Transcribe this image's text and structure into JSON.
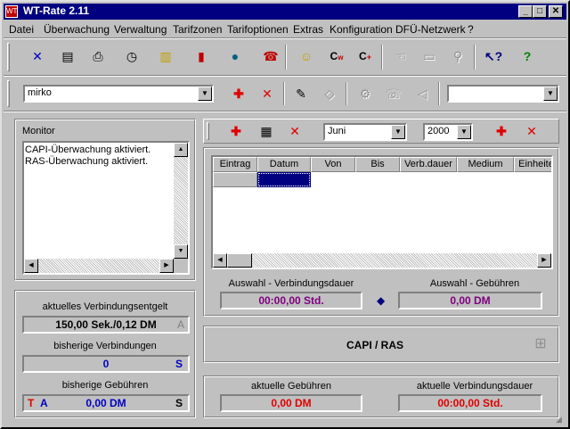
{
  "window": {
    "title": "WT-Rate 2.11",
    "icon_label": "WT"
  },
  "menu": [
    {
      "label": "Datei"
    },
    {
      "label": "Überwachung"
    },
    {
      "label": "Verwaltung"
    },
    {
      "label": "Tarifzonen"
    },
    {
      "label": "Tarifoptionen"
    },
    {
      "label": "Extras"
    },
    {
      "label": "Konfiguration"
    },
    {
      "label": "DFÜ-Netzwerk"
    },
    {
      "label": "?"
    }
  ],
  "toolbar": {
    "icons": [
      "close-x-icon",
      "document-icon",
      "printer-icon",
      "stopwatch-icon",
      "books-icon",
      "chart-icon",
      "globe-icon",
      "phone-icon",
      "smiley-icon",
      "cost-w-icon",
      "cost-plus-icon",
      "hand-icon",
      "battery-icon",
      "magnifier-icon",
      "context-help-icon",
      "help-icon"
    ]
  },
  "profile": {
    "selected": "mirko"
  },
  "profile_right_combo": {
    "value": ""
  },
  "monitor": {
    "title": "Monitor",
    "lines": [
      "CAPI-Überwachung aktiviert.",
      "RAS-Überwachung aktiviert."
    ]
  },
  "left_panel": {
    "entgelt_label": "aktuelles Verbindungsentgelt",
    "entgelt_value": "150,00 Sek./0,12 DM",
    "entgelt_suffix": "A",
    "verbindungen_label": "bisherige Verbindungen",
    "verbindungen_value": "0",
    "verbindungen_suffix": "S",
    "gebuehren_label": "bisherige Gebühren",
    "gebuehren_prefix_t": "T",
    "gebuehren_prefix_a": "A",
    "gebuehren_value": "0,00 DM",
    "gebuehren_suffix": "S"
  },
  "filter": {
    "month": "Juni",
    "year": "2000"
  },
  "table": {
    "columns": [
      "Eintrag",
      "Datum",
      "Von",
      "Bis",
      "Verb.dauer",
      "Medium",
      "Einheite"
    ],
    "rows": []
  },
  "auswahl": {
    "dauer_label": "Auswahl - Verbindungsdauer",
    "dauer_value": "00:00,00 Std.",
    "gebuehren_label": "Auswahl - Gebühren",
    "gebuehren_value": "0,00 DM"
  },
  "status": {
    "mode": "CAPI / RAS"
  },
  "aktuell": {
    "gebuehren_label": "aktuelle Gebühren",
    "gebuehren_value": "0,00 DM",
    "dauer_label": "aktuelle Verbindungsdauer",
    "dauer_value": "00:00,00 Std."
  },
  "colors": {
    "titlebar": "#000080",
    "accent_red": "#e00000",
    "accent_blue": "#0000c0",
    "accent_purple": "#800080"
  }
}
